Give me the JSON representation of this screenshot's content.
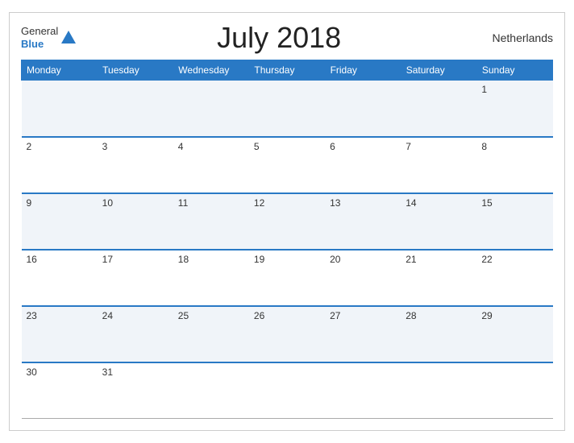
{
  "header": {
    "logo_general": "General",
    "logo_blue": "Blue",
    "title": "July 2018",
    "country": "Netherlands"
  },
  "weekdays": [
    "Monday",
    "Tuesday",
    "Wednesday",
    "Thursday",
    "Friday",
    "Saturday",
    "Sunday"
  ],
  "weeks": [
    [
      "",
      "",
      "",
      "",
      "",
      "",
      "1"
    ],
    [
      "2",
      "3",
      "4",
      "5",
      "6",
      "7",
      "8"
    ],
    [
      "9",
      "10",
      "11",
      "12",
      "13",
      "14",
      "15"
    ],
    [
      "16",
      "17",
      "18",
      "19",
      "20",
      "21",
      "22"
    ],
    [
      "23",
      "24",
      "25",
      "26",
      "27",
      "28",
      "29"
    ],
    [
      "30",
      "31",
      "",
      "",
      "",
      "",
      ""
    ]
  ]
}
